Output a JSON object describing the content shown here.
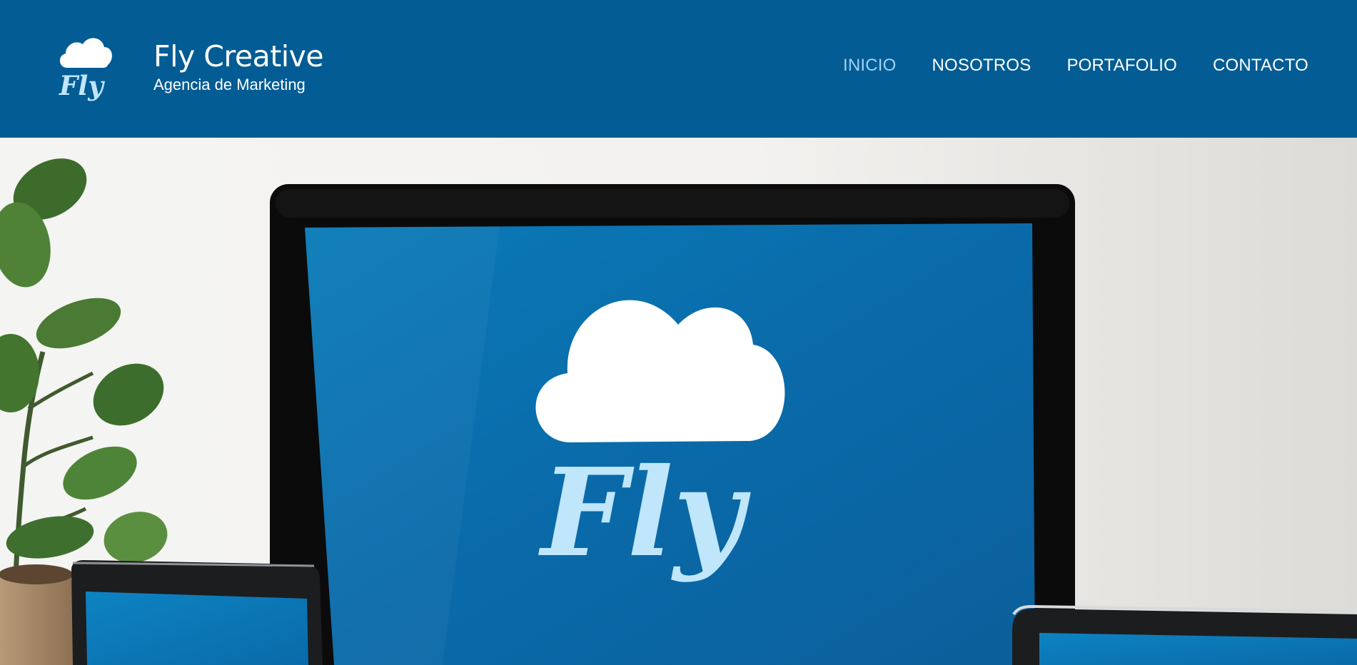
{
  "brand": {
    "title": "Fly Creative",
    "subtitle": "Agencia de Marketing",
    "logo_text": "Fly",
    "logo_icon": "cloud-icon",
    "logo_color": "#bfe6fb"
  },
  "nav": {
    "items": [
      {
        "label": "INICIO",
        "active": true
      },
      {
        "label": "NOSOTROS",
        "active": false
      },
      {
        "label": "PORTAFOLIO",
        "active": false
      },
      {
        "label": "CONTACTO",
        "active": false
      }
    ]
  },
  "hero": {
    "screen_logo_text": "Fly",
    "screen_logo_icon": "cloud-icon"
  },
  "colors": {
    "header_bg": "#035c94",
    "nav_text": "#ffffff",
    "nav_active": "#9fd2f5",
    "screen_blue": "#0a6aa9",
    "logo_light": "#bfe6fb"
  }
}
